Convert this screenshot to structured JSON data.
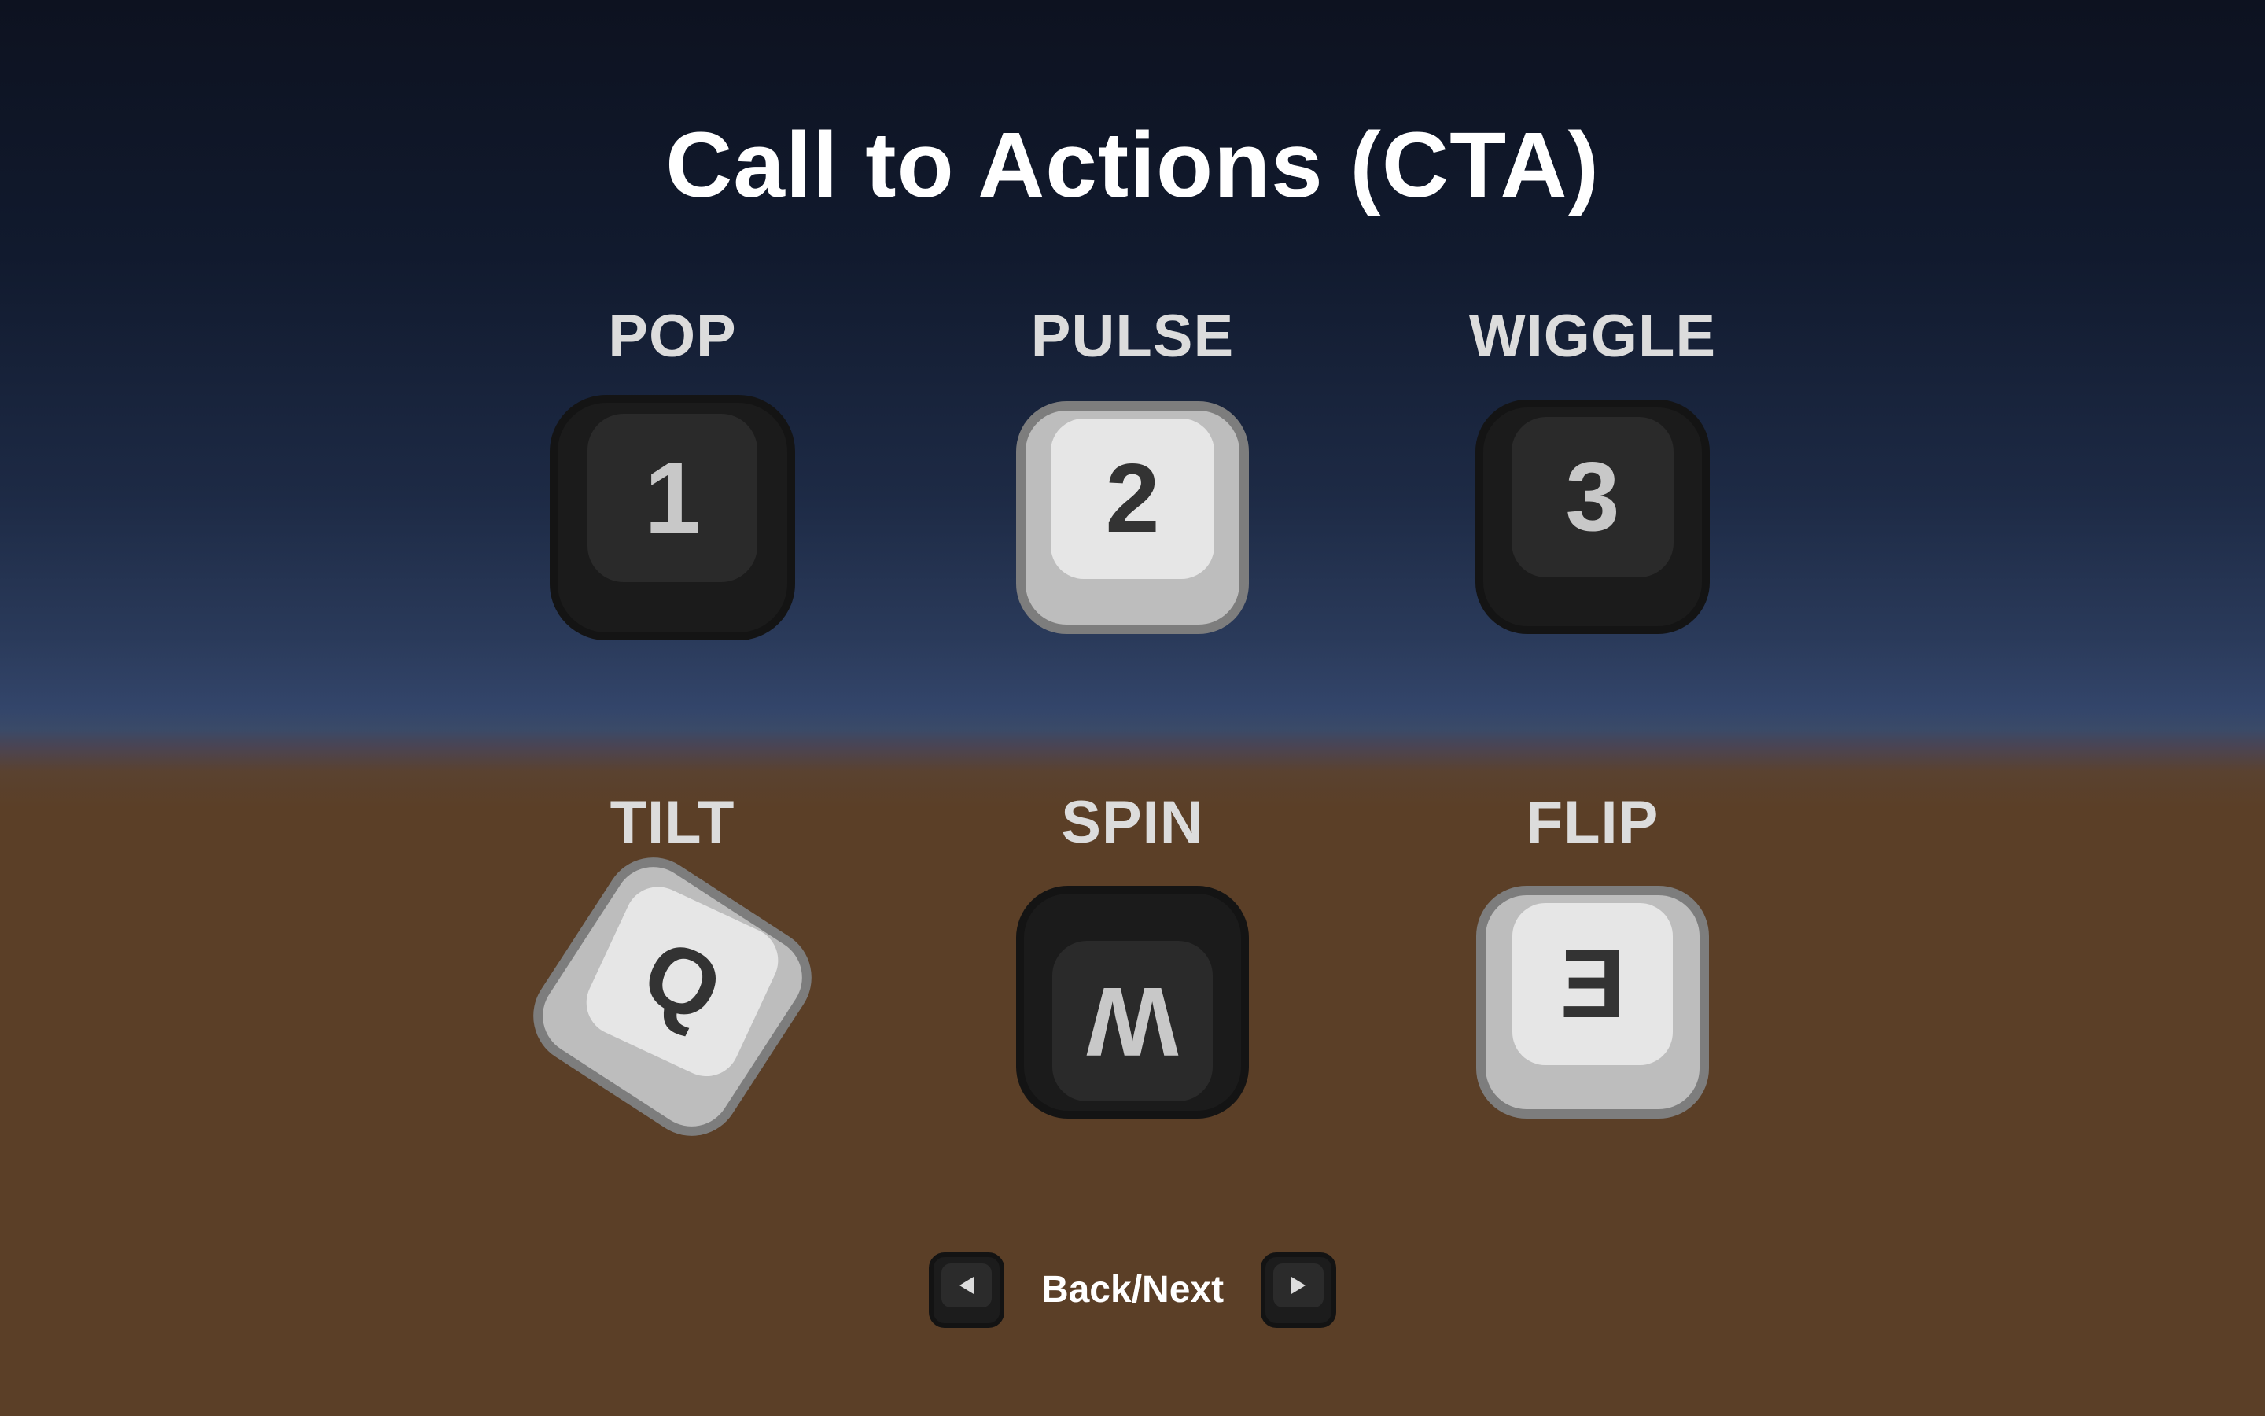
{
  "title": "Call to Actions (CTA)",
  "cells": [
    {
      "label": "POP",
      "key": "1",
      "style": "dark"
    },
    {
      "label": "PULSE",
      "key": "2",
      "style": "light"
    },
    {
      "label": "WIGGLE",
      "key": "3",
      "style": "dark"
    },
    {
      "label": "TILT",
      "key": "Q",
      "style": "light"
    },
    {
      "label": "SPIN",
      "key": "W",
      "style": "dark"
    },
    {
      "label": "FLIP",
      "key": "E",
      "style": "light"
    }
  ],
  "nav": {
    "label": "Back/Next",
    "back_icon": "arrow-left-icon",
    "next_icon": "arrow-right-icon"
  },
  "colors": {
    "sky_top": "#0d1220",
    "horizon": "#33456a",
    "ground": "#5b3f27",
    "dark_key": "#1b1b1b",
    "light_key": "#e6e6e6"
  }
}
